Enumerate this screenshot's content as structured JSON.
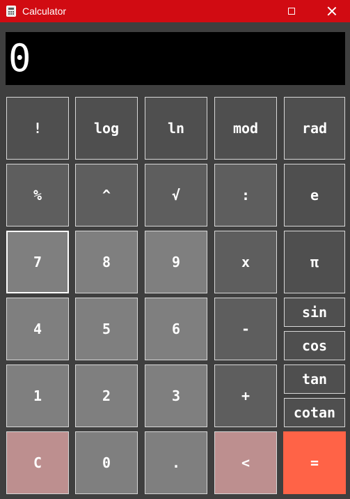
{
  "window": {
    "title": "Calculator"
  },
  "display": {
    "value": "0"
  },
  "buttons": {
    "factorial": "!",
    "log": "log",
    "ln": "ln",
    "mod": "mod",
    "rad": "rad",
    "percent": "%",
    "power": "^",
    "sqrt": "√",
    "divide": ":",
    "e": "e",
    "seven": "7",
    "eight": "8",
    "nine": "9",
    "multiply": "x",
    "pi": "π",
    "four": "4",
    "five": "5",
    "six": "6",
    "minus": "-",
    "sin": "sin",
    "cos": "cos",
    "one": "1",
    "two": "2",
    "three": "3",
    "plus": "+",
    "tan": "tan",
    "cotan": "cotan",
    "clear": "C",
    "zero": "0",
    "dot": ".",
    "backspace": "<",
    "equals": "="
  },
  "colors": {
    "titlebar": "#d10b12",
    "equals": "#ff6347",
    "clear_backspace": "#bd8f8f"
  }
}
